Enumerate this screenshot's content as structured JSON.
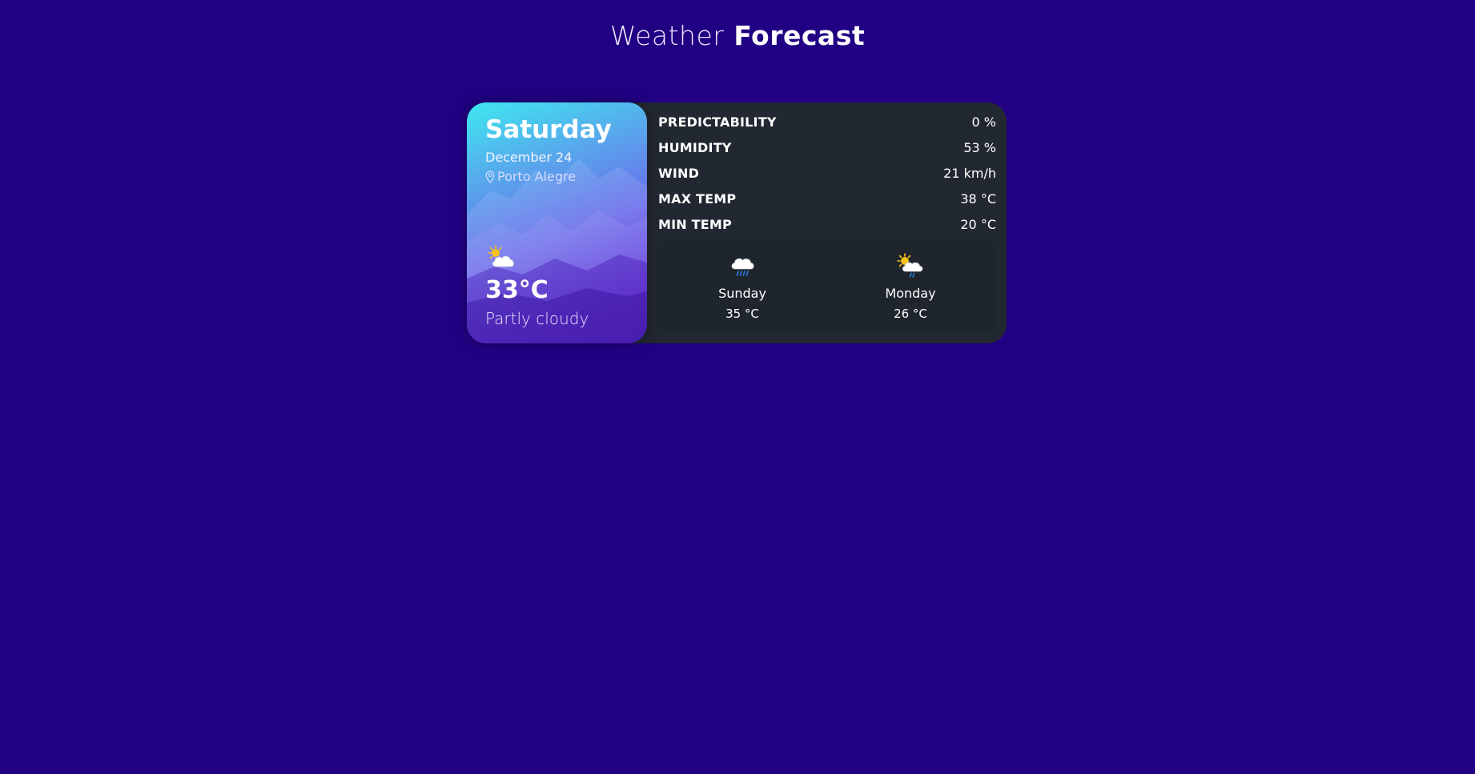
{
  "header": {
    "title_light": "Weather",
    "title_bold": "Forecast"
  },
  "current": {
    "day": "Saturday",
    "date": "December 24",
    "location": "Porto Alegre",
    "icon": "partly-cloudy-icon",
    "temp": "33°C",
    "description": "Partly cloudy"
  },
  "details": [
    {
      "label": "PREDICTABILITY",
      "value": "0 %"
    },
    {
      "label": "HUMIDITY",
      "value": "53 %"
    },
    {
      "label": "WIND",
      "value": "21 km/h"
    },
    {
      "label": "MAX TEMP",
      "value": "38 °C"
    },
    {
      "label": "MIN TEMP",
      "value": "20 °C"
    }
  ],
  "forecast": [
    {
      "day": "Sunday",
      "temp": "35 °C",
      "icon": "rain-cloud-icon"
    },
    {
      "day": "Monday",
      "temp": "26 °C",
      "icon": "sun-cloud-rain-icon"
    }
  ],
  "colors": {
    "background": "#210084",
    "card": "#222831",
    "gradient_top": "#3ee8f0",
    "gradient_bottom": "#4a12c0"
  }
}
